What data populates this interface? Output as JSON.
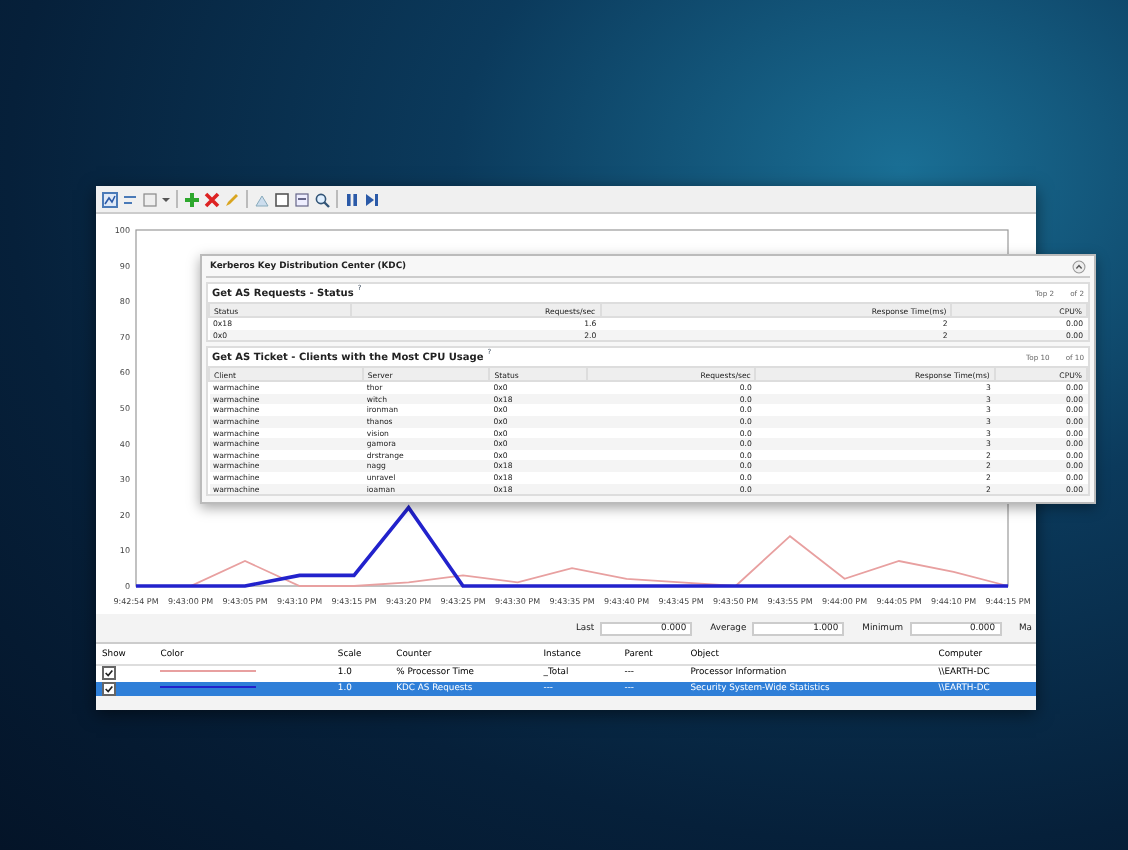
{
  "chart": {
    "chart_data": {
      "type": "line",
      "x": [
        "9:42:54 PM",
        "9:43:00 PM",
        "9:43:05 PM",
        "9:43:10 PM",
        "9:43:15 PM",
        "9:43:20 PM",
        "9:43:25 PM",
        "9:43:30 PM",
        "9:43:35 PM",
        "9:43:40 PM",
        "9:43:45 PM",
        "9:43:50 PM",
        "9:43:55 PM",
        "9:44:00 PM",
        "9:44:05 PM",
        "9:44:10 PM",
        "9:44:15 PM"
      ],
      "series": [
        {
          "color": "#e8a0a0",
          "values": [
            0,
            0,
            7,
            0,
            0,
            1,
            3,
            1,
            5,
            2,
            1,
            0,
            14,
            2,
            7,
            4,
            0
          ]
        },
        {
          "color": "#2222cc",
          "values": [
            0,
            0,
            0,
            3,
            3,
            22,
            0,
            0,
            0,
            0,
            0,
            0,
            0,
            0,
            0,
            0,
            0
          ]
        }
      ],
      "ylim": [
        0,
        100
      ],
      "yticks": [
        0,
        10,
        20,
        30,
        40,
        50,
        60,
        70,
        80,
        90,
        100
      ]
    }
  },
  "kdc_panel": {
    "title": "Kerberos Key Distribution Center (KDC)",
    "sections": [
      {
        "title": "Get AS Requests - Status",
        "help": "?",
        "top": "Top 2",
        "of": "of 2",
        "columns": [
          "Status",
          "Requests/sec",
          "Response Time(ms)",
          "CPU%"
        ],
        "rows": [
          [
            "0x18",
            "1.6",
            "2",
            "0.00"
          ],
          [
            "0x0",
            "2.0",
            "2",
            "0.00"
          ]
        ]
      },
      {
        "title": "Get AS Ticket - Clients with the Most CPU Usage",
        "help": "?",
        "top": "Top 10",
        "of": "of 10",
        "columns": [
          "Client",
          "Server",
          "Status",
          "Requests/sec",
          "Response Time(ms)",
          "CPU%"
        ],
        "rows": [
          [
            "warmachine",
            "thor",
            "0x0",
            "0.0",
            "3",
            "0.00"
          ],
          [
            "warmachine",
            "witch",
            "0x18",
            "0.0",
            "3",
            "0.00"
          ],
          [
            "warmachine",
            "ironman",
            "0x0",
            "0.0",
            "3",
            "0.00"
          ],
          [
            "warmachine",
            "thanos",
            "0x0",
            "0.0",
            "3",
            "0.00"
          ],
          [
            "warmachine",
            "vision",
            "0x0",
            "0.0",
            "3",
            "0.00"
          ],
          [
            "warmachine",
            "gamora",
            "0x0",
            "0.0",
            "3",
            "0.00"
          ],
          [
            "warmachine",
            "drstrange",
            "0x0",
            "0.0",
            "2",
            "0.00"
          ],
          [
            "warmachine",
            "nagg",
            "0x18",
            "0.0",
            "2",
            "0.00"
          ],
          [
            "warmachine",
            "unravel",
            "0x18",
            "0.0",
            "2",
            "0.00"
          ],
          [
            "warmachine",
            "ioaman",
            "0x18",
            "0.0",
            "2",
            "0.00"
          ]
        ]
      }
    ]
  },
  "stats": [
    {
      "label": "Last",
      "value": "0.000"
    },
    {
      "label": "Average",
      "value": "1.000"
    },
    {
      "label": "Minimum",
      "value": "0.000"
    },
    {
      "label": "Ma"
    }
  ],
  "counters": {
    "columns": [
      "Show",
      "Color",
      "Scale",
      "Counter",
      "Instance",
      "Parent",
      "Object",
      "Computer"
    ],
    "rows": [
      {
        "checked": true,
        "selected": false,
        "color": "#e8a0a0",
        "scale": "1.0",
        "counter": "% Processor Time",
        "instance": "_Total",
        "parent": "---",
        "object": "Processor Information",
        "computer": "\\\\EARTH-DC"
      },
      {
        "checked": true,
        "selected": true,
        "color": "#2222cc",
        "scale": "1.0",
        "counter": "KDC AS Requests",
        "instance": "---",
        "parent": "---",
        "object": "Security System-Wide Statistics",
        "computer": "\\\\EARTH-DC"
      }
    ]
  }
}
